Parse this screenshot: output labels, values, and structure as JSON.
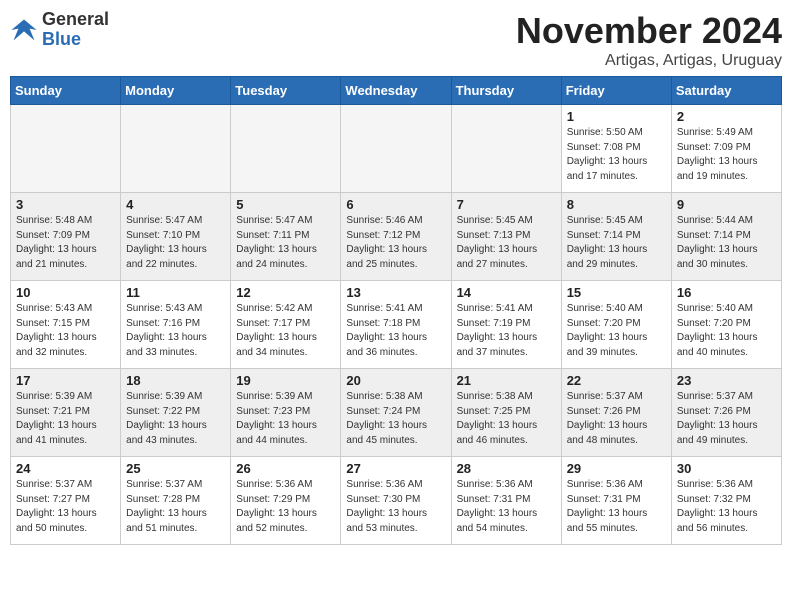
{
  "logo": {
    "general": "General",
    "blue": "Blue"
  },
  "title": "November 2024",
  "location": "Artigas, Artigas, Uruguay",
  "days_of_week": [
    "Sunday",
    "Monday",
    "Tuesday",
    "Wednesday",
    "Thursday",
    "Friday",
    "Saturday"
  ],
  "weeks": [
    [
      {
        "day": "",
        "info": "",
        "empty": true
      },
      {
        "day": "",
        "info": "",
        "empty": true
      },
      {
        "day": "",
        "info": "",
        "empty": true
      },
      {
        "day": "",
        "info": "",
        "empty": true
      },
      {
        "day": "",
        "info": "",
        "empty": true
      },
      {
        "day": "1",
        "info": "Sunrise: 5:50 AM\nSunset: 7:08 PM\nDaylight: 13 hours\nand 17 minutes."
      },
      {
        "day": "2",
        "info": "Sunrise: 5:49 AM\nSunset: 7:09 PM\nDaylight: 13 hours\nand 19 minutes."
      }
    ],
    [
      {
        "day": "3",
        "info": "Sunrise: 5:48 AM\nSunset: 7:09 PM\nDaylight: 13 hours\nand 21 minutes."
      },
      {
        "day": "4",
        "info": "Sunrise: 5:47 AM\nSunset: 7:10 PM\nDaylight: 13 hours\nand 22 minutes."
      },
      {
        "day": "5",
        "info": "Sunrise: 5:47 AM\nSunset: 7:11 PM\nDaylight: 13 hours\nand 24 minutes."
      },
      {
        "day": "6",
        "info": "Sunrise: 5:46 AM\nSunset: 7:12 PM\nDaylight: 13 hours\nand 25 minutes."
      },
      {
        "day": "7",
        "info": "Sunrise: 5:45 AM\nSunset: 7:13 PM\nDaylight: 13 hours\nand 27 minutes."
      },
      {
        "day": "8",
        "info": "Sunrise: 5:45 AM\nSunset: 7:14 PM\nDaylight: 13 hours\nand 29 minutes."
      },
      {
        "day": "9",
        "info": "Sunrise: 5:44 AM\nSunset: 7:14 PM\nDaylight: 13 hours\nand 30 minutes."
      }
    ],
    [
      {
        "day": "10",
        "info": "Sunrise: 5:43 AM\nSunset: 7:15 PM\nDaylight: 13 hours\nand 32 minutes."
      },
      {
        "day": "11",
        "info": "Sunrise: 5:43 AM\nSunset: 7:16 PM\nDaylight: 13 hours\nand 33 minutes."
      },
      {
        "day": "12",
        "info": "Sunrise: 5:42 AM\nSunset: 7:17 PM\nDaylight: 13 hours\nand 34 minutes."
      },
      {
        "day": "13",
        "info": "Sunrise: 5:41 AM\nSunset: 7:18 PM\nDaylight: 13 hours\nand 36 minutes."
      },
      {
        "day": "14",
        "info": "Sunrise: 5:41 AM\nSunset: 7:19 PM\nDaylight: 13 hours\nand 37 minutes."
      },
      {
        "day": "15",
        "info": "Sunrise: 5:40 AM\nSunset: 7:20 PM\nDaylight: 13 hours\nand 39 minutes."
      },
      {
        "day": "16",
        "info": "Sunrise: 5:40 AM\nSunset: 7:20 PM\nDaylight: 13 hours\nand 40 minutes."
      }
    ],
    [
      {
        "day": "17",
        "info": "Sunrise: 5:39 AM\nSunset: 7:21 PM\nDaylight: 13 hours\nand 41 minutes."
      },
      {
        "day": "18",
        "info": "Sunrise: 5:39 AM\nSunset: 7:22 PM\nDaylight: 13 hours\nand 43 minutes."
      },
      {
        "day": "19",
        "info": "Sunrise: 5:39 AM\nSunset: 7:23 PM\nDaylight: 13 hours\nand 44 minutes."
      },
      {
        "day": "20",
        "info": "Sunrise: 5:38 AM\nSunset: 7:24 PM\nDaylight: 13 hours\nand 45 minutes."
      },
      {
        "day": "21",
        "info": "Sunrise: 5:38 AM\nSunset: 7:25 PM\nDaylight: 13 hours\nand 46 minutes."
      },
      {
        "day": "22",
        "info": "Sunrise: 5:37 AM\nSunset: 7:26 PM\nDaylight: 13 hours\nand 48 minutes."
      },
      {
        "day": "23",
        "info": "Sunrise: 5:37 AM\nSunset: 7:26 PM\nDaylight: 13 hours\nand 49 minutes."
      }
    ],
    [
      {
        "day": "24",
        "info": "Sunrise: 5:37 AM\nSunset: 7:27 PM\nDaylight: 13 hours\nand 50 minutes."
      },
      {
        "day": "25",
        "info": "Sunrise: 5:37 AM\nSunset: 7:28 PM\nDaylight: 13 hours\nand 51 minutes."
      },
      {
        "day": "26",
        "info": "Sunrise: 5:36 AM\nSunset: 7:29 PM\nDaylight: 13 hours\nand 52 minutes."
      },
      {
        "day": "27",
        "info": "Sunrise: 5:36 AM\nSunset: 7:30 PM\nDaylight: 13 hours\nand 53 minutes."
      },
      {
        "day": "28",
        "info": "Sunrise: 5:36 AM\nSunset: 7:31 PM\nDaylight: 13 hours\nand 54 minutes."
      },
      {
        "day": "29",
        "info": "Sunrise: 5:36 AM\nSunset: 7:31 PM\nDaylight: 13 hours\nand 55 minutes."
      },
      {
        "day": "30",
        "info": "Sunrise: 5:36 AM\nSunset: 7:32 PM\nDaylight: 13 hours\nand 56 minutes."
      }
    ]
  ]
}
